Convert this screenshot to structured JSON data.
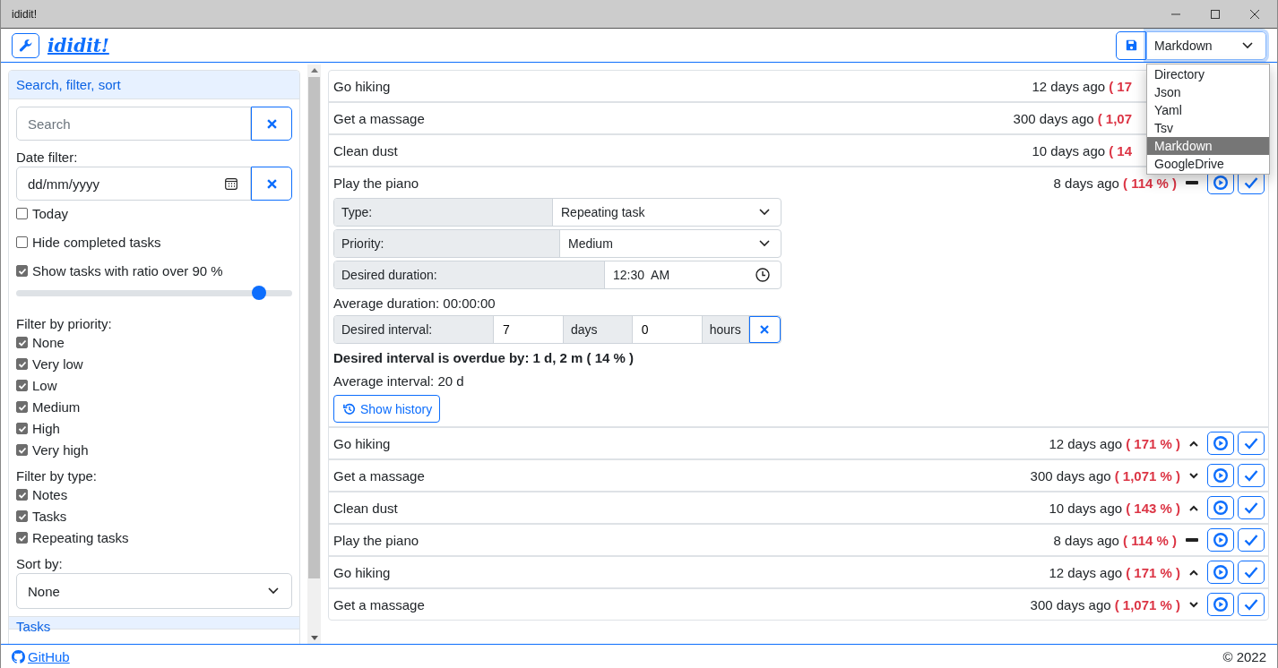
{
  "window": {
    "title": "ididit!"
  },
  "header": {
    "app_name": "ididit!",
    "storage_select": {
      "value": "Markdown",
      "expanded": true,
      "options": [
        {
          "label": "Directory",
          "selected": false
        },
        {
          "label": "Json",
          "selected": false
        },
        {
          "label": "Yaml",
          "selected": false
        },
        {
          "label": "Tsv",
          "selected": false
        },
        {
          "label": "Markdown",
          "selected": true
        },
        {
          "label": "GoogleDrive",
          "selected": false
        }
      ]
    }
  },
  "sidebar": {
    "title": "Search, filter, sort",
    "search": {
      "placeholder": "Search"
    },
    "date_filter": {
      "label": "Date filter:",
      "placeholder": "dd/mm/yyyy"
    },
    "options": [
      {
        "label": "Today",
        "checked": false
      },
      {
        "label": "Hide completed tasks",
        "checked": false
      },
      {
        "label": "Show tasks with ratio over 90 %",
        "checked": true
      }
    ],
    "ratio_slider": {
      "level": 0.88
    },
    "priority_filter": {
      "label": "Filter by priority:",
      "items": [
        {
          "label": "None",
          "checked": true
        },
        {
          "label": "Very low",
          "checked": true
        },
        {
          "label": "Low",
          "checked": true
        },
        {
          "label": "Medium",
          "checked": true
        },
        {
          "label": "High",
          "checked": true
        },
        {
          "label": "Very high",
          "checked": true
        }
      ]
    },
    "type_filter": {
      "label": "Filter by type:",
      "items": [
        {
          "label": "Notes",
          "checked": true
        },
        {
          "label": "Tasks",
          "checked": true
        },
        {
          "label": "Repeating tasks",
          "checked": true
        }
      ]
    },
    "sort": {
      "label": "Sort by:",
      "value": "None"
    },
    "next_section": "Tasks"
  },
  "tasks": [
    {
      "name": "Go hiking",
      "age": "12 days ago",
      "ratio": "( 17",
      "buttons": false
    },
    {
      "name": "Get a massage",
      "age": "300 days ago",
      "ratio": "( 1,07",
      "buttons": false
    },
    {
      "name": "Clean dust",
      "age": "10 days ago",
      "ratio": "( 14",
      "buttons": false
    },
    {
      "name": "Play the piano",
      "age": "8 days ago",
      "ratio": "( 114 % )",
      "trend": {
        "kind": "flat"
      },
      "buttons": true,
      "details": {
        "fields": [
          {
            "label": "Type:",
            "value": "Repeating task",
            "kind": "select"
          },
          {
            "label": "Priority:",
            "value": "Medium",
            "kind": "select"
          },
          {
            "label": "Desired duration:",
            "value": "12:30  AM",
            "kind": "time"
          }
        ],
        "average_duration": "Average duration: 00:00:00",
        "interval": {
          "label": "Desired interval:",
          "days": "7",
          "days_unit": "days",
          "hours": "0",
          "hours_unit": "hours"
        },
        "overdue": "Desired interval is overdue by: 1 d, 2 m ( 14 % )",
        "average_interval": "Average interval: 20 d",
        "history_button": "Show history"
      }
    },
    {
      "name": "Go hiking",
      "age": "12 days ago",
      "ratio": "( 171 % )",
      "trend": {
        "kind": "up"
      },
      "buttons": true
    },
    {
      "name": "Get a massage",
      "age": "300 days ago",
      "ratio": "( 1,071 % )",
      "trend": {
        "kind": "down"
      },
      "buttons": true
    },
    {
      "name": "Clean dust",
      "age": "10 days ago",
      "ratio": "( 143 % )",
      "trend": {
        "kind": "up"
      },
      "buttons": true
    },
    {
      "name": "Play the piano",
      "age": "8 days ago",
      "ratio": "( 114 % )",
      "trend": {
        "kind": "flat"
      },
      "buttons": true
    },
    {
      "name": "Go hiking",
      "age": "12 days ago",
      "ratio": "( 171 % )",
      "trend": {
        "kind": "up"
      },
      "buttons": true
    },
    {
      "name": "Get a massage",
      "age": "300 days ago",
      "ratio": "( 1,071 % )",
      "trend": {
        "kind": "down"
      },
      "buttons": true
    }
  ],
  "footer": {
    "link": "GitHub",
    "copyright": "© 2022"
  }
}
